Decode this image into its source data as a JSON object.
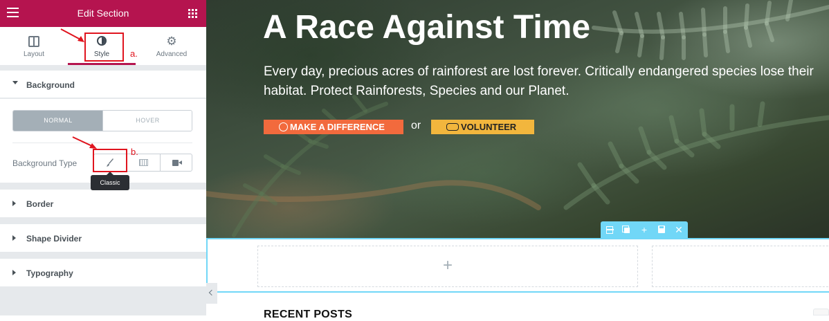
{
  "editor": {
    "title": "Edit Section",
    "tabs": [
      {
        "label": "Layout"
      },
      {
        "label": "Style"
      },
      {
        "label": "Advanced"
      }
    ],
    "sections": {
      "background": "Background",
      "border": "Border",
      "shape_divider": "Shape Divider",
      "typography": "Typography"
    },
    "state_toggle": {
      "normal": "NORMAL",
      "hover": "HOVER"
    },
    "background_type_label": "Background Type",
    "tooltip": "Classic",
    "annotations": {
      "a": "a.",
      "b": "b."
    },
    "accent_color": "#b5144f",
    "annotation_color": "#e0141e"
  },
  "hero": {
    "heading": "A Race Against Time",
    "description": "Every day, precious acres of rainforest are lost forever. Critically endangered species lose their habitat. Protect Rainforests, Species and our Planet.",
    "primary_button": "MAKE A DIFFERENCE",
    "separator": "or",
    "secondary_button": "VOLUNTEER",
    "primary_color": "#f26a3d",
    "secondary_color": "#f2b63d"
  },
  "section_toolbar": {
    "add_symbol": "+",
    "close_symbol": "✕",
    "color": "#71d7f7"
  },
  "empty_section": {
    "add_symbol": "+"
  },
  "recent_posts": {
    "heading": "RECENT POSTS"
  }
}
